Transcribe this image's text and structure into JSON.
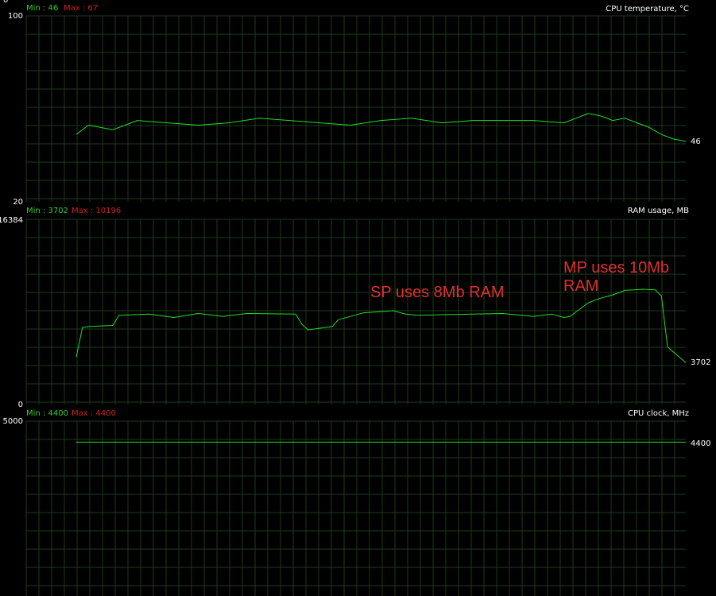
{
  "panels": [
    {
      "title": "CPU temperature, °C",
      "min_label": "Min : 46",
      "max_label": "Max : 67",
      "y_max_label": "100",
      "y_min_label": "20",
      "current_label": "46"
    },
    {
      "title": "RAM usage, MB",
      "min_label": "Min : 3702",
      "max_label": "Max : 10196",
      "y_max_label": "16384",
      "y_min_label": "0",
      "current_label": "3702"
    },
    {
      "title": "CPU clock, MHz",
      "min_label": "Min : 4400",
      "max_label": "Max : 4400",
      "y_max_label": "5000",
      "y_min_label": "",
      "current_label": "4400"
    }
  ],
  "top_zero_label": "0",
  "annotations": {
    "sp": "SP uses 8Mb RAM",
    "mp_line1": "MP uses 10Mb",
    "mp_line2": "RAM"
  },
  "colors": {
    "series": "#22dd22",
    "grid": "#1d3a1d",
    "min": "#33cc33",
    "max": "#cc2222",
    "annotation": "#e03030"
  },
  "chart_data": [
    {
      "type": "line",
      "title": "CPU temperature, °C",
      "ylim": [
        20,
        100
      ],
      "x": [
        0,
        2,
        4,
        6,
        8,
        10,
        15,
        20,
        25,
        30,
        35,
        40,
        45,
        50,
        55,
        60,
        65,
        70,
        75,
        80,
        82,
        84,
        86,
        88,
        90,
        92,
        94,
        96,
        98,
        100
      ],
      "values": [
        49,
        53,
        52,
        51,
        53,
        55,
        54,
        53,
        54,
        56,
        55,
        54,
        53,
        55,
        56,
        54,
        55,
        55,
        55,
        54,
        56,
        58,
        57,
        55,
        56,
        54,
        52,
        49,
        47,
        46
      ],
      "series": [
        {
          "name": "",
          "values": [
            49,
            53,
            52,
            51,
            53,
            55,
            54,
            53,
            54,
            56,
            55,
            54,
            53,
            55,
            56,
            54,
            55,
            55,
            55,
            54,
            56,
            58,
            57,
            55,
            56,
            54,
            52,
            49,
            47,
            46
          ]
        }
      ]
    },
    {
      "type": "line",
      "title": "RAM usage, MB",
      "ylim": [
        0,
        16384
      ],
      "x": [
        0,
        1,
        2,
        6,
        7,
        12,
        16,
        20,
        24,
        28,
        36,
        37,
        38,
        42,
        43,
        47,
        52,
        54,
        56,
        65,
        70,
        75,
        78,
        80,
        81,
        84,
        86,
        88,
        90,
        93,
        95,
        96,
        97,
        100
      ],
      "values": [
        4200,
        6800,
        6900,
        7000,
        7900,
        8000,
        7700,
        8050,
        7800,
        8050,
        8000,
        7100,
        6600,
        6900,
        7500,
        8100,
        8300,
        8000,
        7900,
        8000,
        8050,
        7800,
        8000,
        7700,
        7800,
        9000,
        9400,
        9700,
        10100,
        10196,
        10150,
        9600,
        5100,
        3702
      ]
    },
    {
      "type": "line",
      "title": "CPU clock, MHz",
      "ylim": [
        0,
        5000
      ],
      "x": [
        0,
        100
      ],
      "values": [
        4400,
        4400
      ]
    }
  ]
}
